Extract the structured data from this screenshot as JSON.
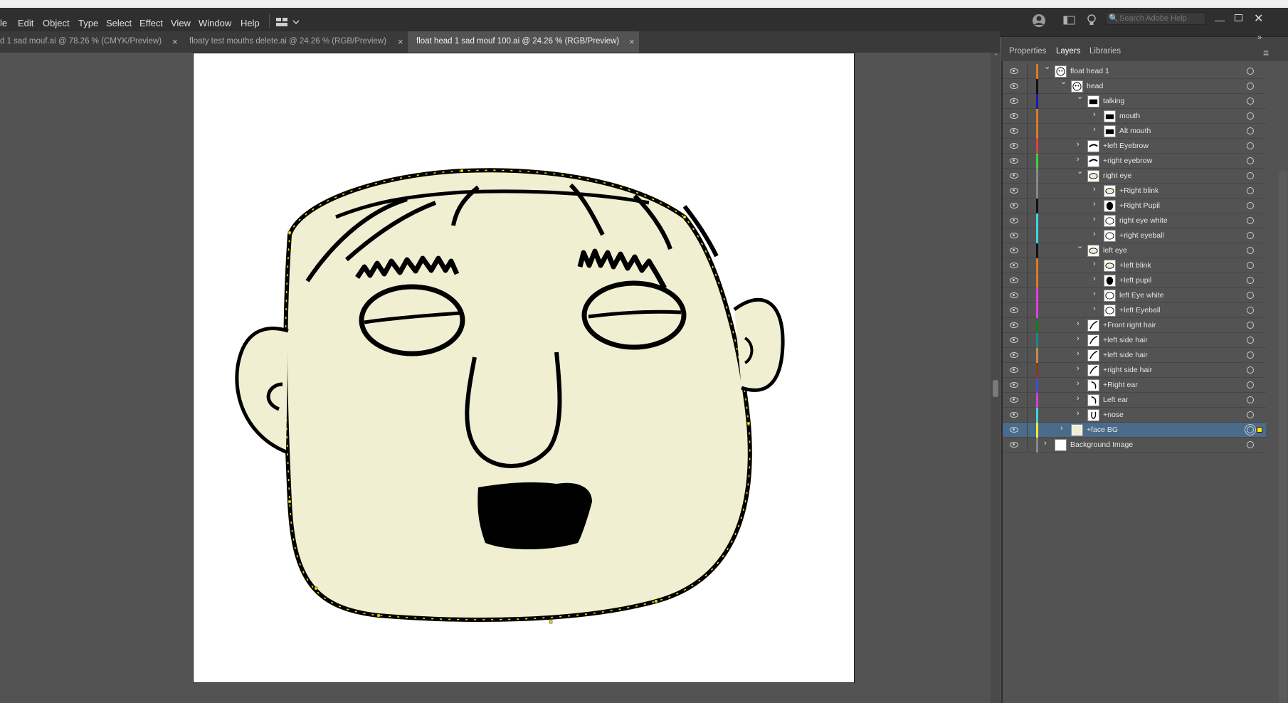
{
  "menu": {
    "items": [
      "le",
      "Edit",
      "Object",
      "Type",
      "Select",
      "Effect",
      "View",
      "Window",
      "Help"
    ]
  },
  "search": {
    "placeholder": "Search Adobe Help"
  },
  "tabs": [
    {
      "label": "d 1 sad mouf.ai @ 78.26 % (CMYK/Preview)",
      "active": false
    },
    {
      "label": "floaty test mouths delete.ai @ 24.26 % (RGB/Preview)",
      "active": false
    },
    {
      "label": "float head 1 sad mouf 100.ai @ 24.26 % (RGB/Preview)",
      "active": true
    }
  ],
  "panel": {
    "tabs": [
      "Properties",
      "Layers",
      "Libraries"
    ],
    "active_tab": "Layers"
  },
  "layers": [
    {
      "name": "float head 1",
      "depth": 0,
      "expanded": true,
      "color": "#e07b1f",
      "thumb": "face"
    },
    {
      "name": "head",
      "depth": 1,
      "expanded": true,
      "color": "#111111",
      "thumb": "face"
    },
    {
      "name": "talking",
      "depth": 2,
      "expanded": true,
      "color": "#1b1bb0",
      "thumb": "mouth"
    },
    {
      "name": "mouth",
      "depth": 3,
      "expanded": false,
      "color": "#e07b1f",
      "thumb": "mouth"
    },
    {
      "name": "Alt mouth",
      "depth": 3,
      "expanded": false,
      "color": "#e07b1f",
      "thumb": "mouth"
    },
    {
      "name": "+left Eyebrow",
      "depth": 2,
      "expanded": false,
      "color": "#e04040",
      "thumb": "brow"
    },
    {
      "name": "+right eyebrow",
      "depth": 2,
      "expanded": false,
      "color": "#3ed13e",
      "thumb": "brow"
    },
    {
      "name": "right eye",
      "depth": 2,
      "expanded": true,
      "color": "#888888",
      "thumb": "eye"
    },
    {
      "name": "+Right blink",
      "depth": 3,
      "expanded": false,
      "color": "#888888",
      "thumb": "eye"
    },
    {
      "name": "+Right Pupil",
      "depth": 3,
      "expanded": false,
      "color": "#111111",
      "thumb": "pupil"
    },
    {
      "name": "right eye white",
      "depth": 3,
      "expanded": false,
      "color": "#3ed6e0",
      "thumb": "white"
    },
    {
      "name": "+right eyeball",
      "depth": 3,
      "expanded": false,
      "color": "#3ed6e0",
      "thumb": "white"
    },
    {
      "name": "left eye",
      "depth": 2,
      "expanded": true,
      "color": "#111111",
      "thumb": "eye"
    },
    {
      "name": "+left blink",
      "depth": 3,
      "expanded": false,
      "color": "#e07b1f",
      "thumb": "eye"
    },
    {
      "name": "+left pupil",
      "depth": 3,
      "expanded": false,
      "color": "#e07b1f",
      "thumb": "pupil"
    },
    {
      "name": "left Eye white",
      "depth": 3,
      "expanded": false,
      "color": "#e040e0",
      "thumb": "white"
    },
    {
      "name": "+left Eyeball",
      "depth": 3,
      "expanded": false,
      "color": "#e040e0",
      "thumb": "white"
    },
    {
      "name": "+Front right hair",
      "depth": 2,
      "expanded": false,
      "color": "#1a7a1a",
      "thumb": "hair"
    },
    {
      "name": "+left side hair",
      "depth": 2,
      "expanded": false,
      "color": "#1a8a8a",
      "thumb": "hair"
    },
    {
      "name": "+left side hair",
      "depth": 2,
      "expanded": false,
      "color": "#c78a4a",
      "thumb": "hair"
    },
    {
      "name": "+right side hair",
      "depth": 2,
      "expanded": false,
      "color": "#8a3a1a",
      "thumb": "hair"
    },
    {
      "name": "+Right ear",
      "depth": 2,
      "expanded": false,
      "color": "#4a4ad0",
      "thumb": "ear"
    },
    {
      "name": "Left ear",
      "depth": 2,
      "expanded": false,
      "color": "#d040d0",
      "thumb": "ear"
    },
    {
      "name": "+nose",
      "depth": 2,
      "expanded": false,
      "color": "#3ed6e0",
      "thumb": "nose"
    },
    {
      "name": "+face BG",
      "depth": 1,
      "expanded": false,
      "color": "#f2ea3a",
      "thumb": "bg",
      "selected": true
    },
    {
      "name": "Background Image",
      "depth": 0,
      "expanded": false,
      "color": "#888888",
      "thumb": "blank"
    }
  ],
  "colors": {
    "face_fill": "#f0efd2",
    "selection": "#ffe800",
    "layer_selected": "#4b6b8a"
  }
}
